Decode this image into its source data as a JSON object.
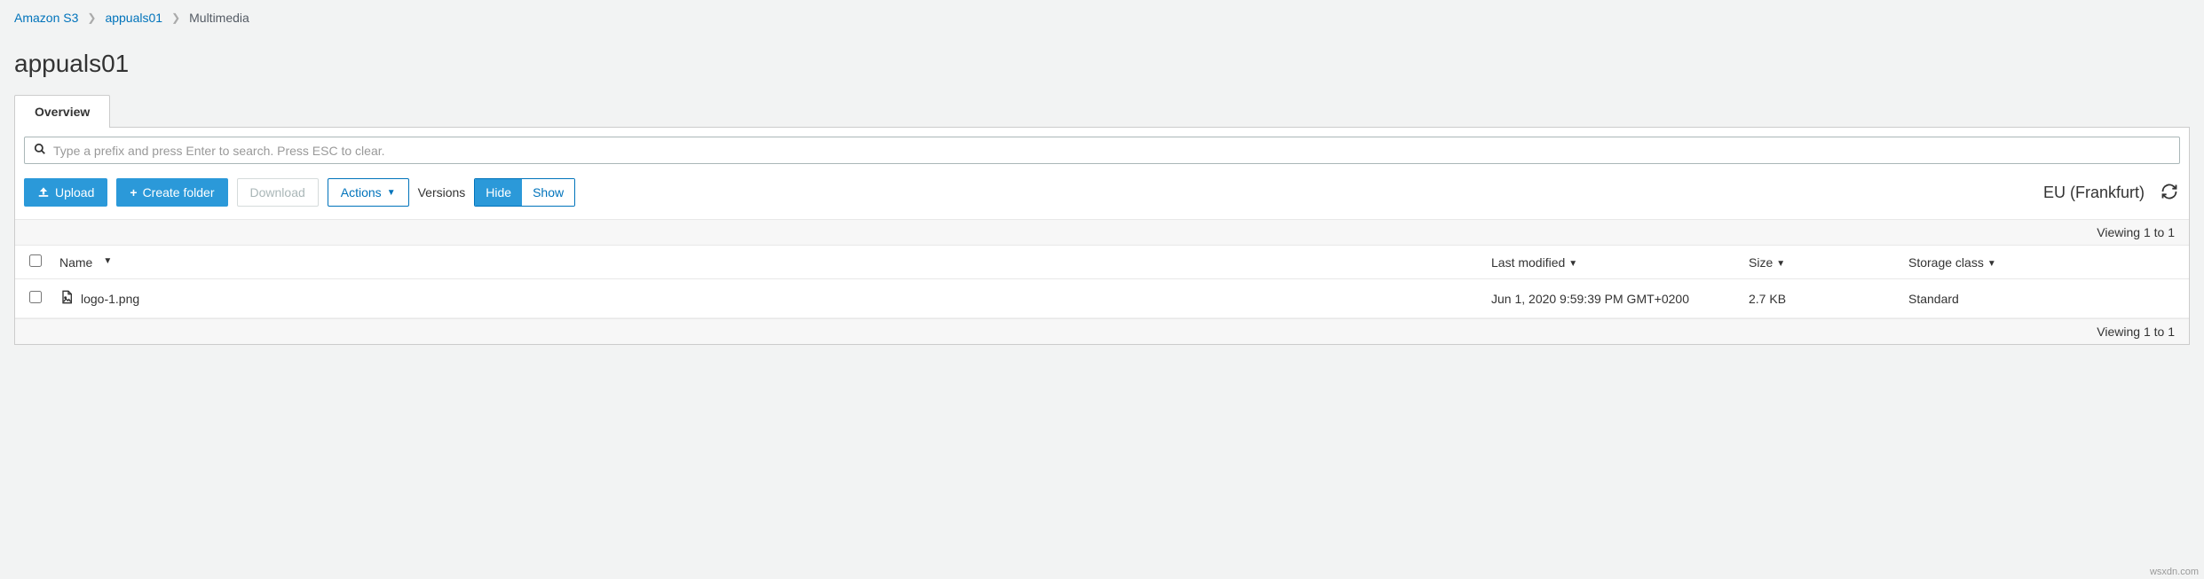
{
  "breadcrumb": {
    "items": [
      {
        "label": "Amazon S3",
        "link": true
      },
      {
        "label": "appuals01",
        "link": true
      },
      {
        "label": "Multimedia",
        "link": false
      }
    ]
  },
  "title": "appuals01",
  "tabs": {
    "overview": "Overview"
  },
  "search": {
    "placeholder": "Type a prefix and press Enter to search. Press ESC to clear."
  },
  "toolbar": {
    "upload": "Upload",
    "create_folder": "Create folder",
    "download": "Download",
    "actions": "Actions",
    "versions_label": "Versions",
    "versions_hide": "Hide",
    "versions_show": "Show",
    "region": "EU (Frankfurt)"
  },
  "pager": {
    "top": "Viewing 1 to 1",
    "bottom": "Viewing 1 to 1"
  },
  "columns": {
    "name": "Name",
    "last_modified": "Last modified",
    "size": "Size",
    "storage_class": "Storage class"
  },
  "rows": [
    {
      "name": "logo-1.png",
      "last_modified": "Jun 1, 2020 9:59:39 PM GMT+0200",
      "size": "2.7 KB",
      "storage_class": "Standard"
    }
  ],
  "watermark": "wsxdn.com"
}
